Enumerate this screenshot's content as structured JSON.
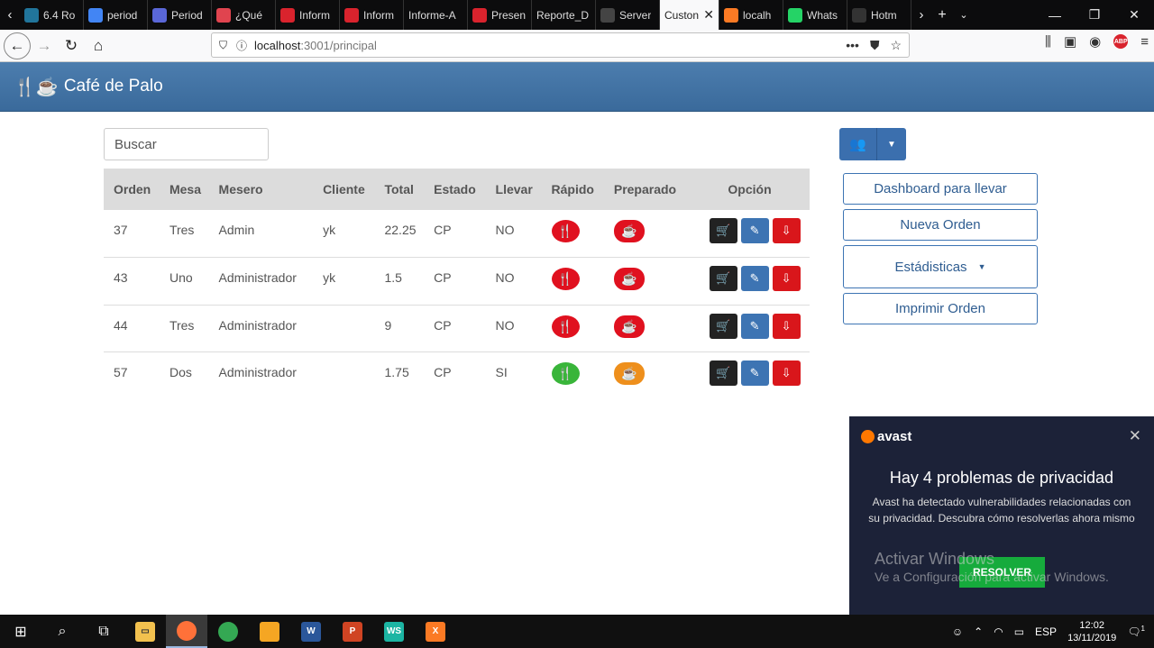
{
  "browser": {
    "tabs": [
      {
        "label": "6.4 Ro",
        "icon": "wordpress-icon",
        "color": "#21759b"
      },
      {
        "label": "period",
        "icon": "google-icon",
        "color": "#4285f4"
      },
      {
        "label": "Period",
        "icon": "globe-icon",
        "color": "#5a67d8"
      },
      {
        "label": "¿Qué",
        "icon": "r-icon",
        "color": "#e0444f"
      },
      {
        "label": "Inform",
        "icon": "doc-icon",
        "color": "#d9232d"
      },
      {
        "label": "Inform",
        "icon": "doc-icon",
        "color": "#d9232d"
      },
      {
        "label": "Informe-A",
        "icon": "",
        "color": ""
      },
      {
        "label": "Presen",
        "icon": "doc-icon",
        "color": "#d9232d"
      },
      {
        "label": "Reporte_D",
        "icon": "",
        "color": ""
      },
      {
        "label": "Server",
        "icon": "warning-icon",
        "color": "#444"
      },
      {
        "label": "Custon",
        "icon": "",
        "color": "",
        "active": true
      },
      {
        "label": "localh",
        "icon": "xampp-icon",
        "color": "#fb7a24"
      },
      {
        "label": "Whats",
        "icon": "whatsapp-icon",
        "color": "#25d366"
      },
      {
        "label": "Hotm",
        "icon": "hotmail-icon",
        "color": "#333"
      }
    ],
    "url_host": "localhost",
    "url_path": ":3001/principal"
  },
  "app": {
    "title": "Café de Palo",
    "search_placeholder": "Buscar"
  },
  "table": {
    "headers": [
      "Orden",
      "Mesa",
      "Mesero",
      "Cliente",
      "Total",
      "Estado",
      "Llevar",
      "Rápido",
      "Preparado",
      "Opción"
    ],
    "rows": [
      {
        "orden": "37",
        "mesa": "Tres",
        "mesero": "Admin",
        "cliente": "yk",
        "total": "22.25",
        "estado": "CP",
        "llevar": "NO",
        "rapido": "red",
        "preparado": "red"
      },
      {
        "orden": "43",
        "mesa": "Uno",
        "mesero": "Administrador",
        "cliente": "yk",
        "total": "1.5",
        "estado": "CP",
        "llevar": "NO",
        "rapido": "red",
        "preparado": "red"
      },
      {
        "orden": "44",
        "mesa": "Tres",
        "mesero": "Administrador",
        "cliente": "",
        "total": "9",
        "estado": "CP",
        "llevar": "NO",
        "rapido": "red",
        "preparado": "red"
      },
      {
        "orden": "57",
        "mesa": "Dos",
        "mesero": "Administrador",
        "cliente": "",
        "total": "1.75",
        "estado": "CP",
        "llevar": "SI",
        "rapido": "green",
        "preparado": "orange"
      }
    ]
  },
  "sidebar": {
    "dashboard": "Dashboard para llevar",
    "nueva_orden": "Nueva Orden",
    "estadisticas": "Estádisticas",
    "imprimir": "Imprimir Orden"
  },
  "avast": {
    "brand": "avast",
    "title": "Hay 4 problemas de privacidad",
    "text": "Avast ha detectado vulnerabilidades relacionadas con su privacidad. Descubra cómo resolverlas ahora mismo",
    "button": "RESOLVER"
  },
  "watermark": {
    "line1": "Activar Windows",
    "line2": "Ve a Configuración para activar Windows."
  },
  "taskbar": {
    "lang": "ESP",
    "time": "12:02",
    "date": "13/11/2019",
    "notifications": "1"
  },
  "colors": {
    "header": "#3f6f9f",
    "accent": "#3d74b3",
    "danger": "#e0111f",
    "success": "#39b53a",
    "warning": "#ee8f1c"
  }
}
